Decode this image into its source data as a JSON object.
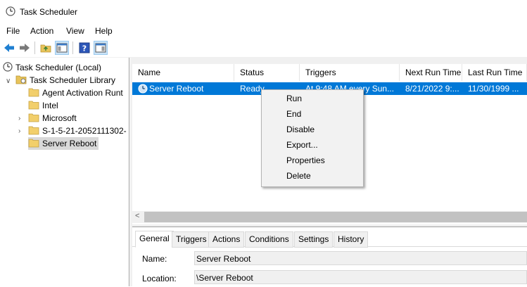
{
  "window": {
    "title": "Task Scheduler",
    "app_icon": "clock-icon"
  },
  "menu": [
    "File",
    "Action",
    "View",
    "Help"
  ],
  "toolbar": {
    "icons": [
      "back-arrow-icon",
      "forward-arrow-icon",
      "up-folder-icon",
      "show-hide-console-tree-icon",
      "help-icon",
      "show-hide-action-pane-icon"
    ]
  },
  "tree": {
    "root": "Task Scheduler (Local)",
    "library": "Task Scheduler Library",
    "folders": [
      "Agent Activation Runt",
      "Intel",
      "Microsoft",
      "S-1-5-21-2052111302-",
      "Server Reboot"
    ]
  },
  "list": {
    "columns": [
      "Name",
      "Status",
      "Triggers",
      "Next Run Time",
      "Last Run Time"
    ],
    "row": [
      "Server Reboot",
      "Ready",
      "At 9:48 AM every Sun...",
      "8/21/2022 9:...",
      "11/30/1999 ..."
    ]
  },
  "scrollbar": {
    "left_arrow": "<"
  },
  "context_menu": [
    "Run",
    "End",
    "Disable",
    "Export...",
    "Properties",
    "Delete"
  ],
  "properties": {
    "tabs": [
      "General",
      "Triggers",
      "Actions",
      "Conditions",
      "Settings",
      "History"
    ],
    "name_label": "Name:",
    "name_value": "Server Reboot",
    "location_label": "Location:",
    "location_value": "\\Server Reboot"
  },
  "colors": {
    "selection": "#0078d7",
    "tree_selected": "#d9d9d9",
    "pane_bg": "#f0f0f0"
  }
}
